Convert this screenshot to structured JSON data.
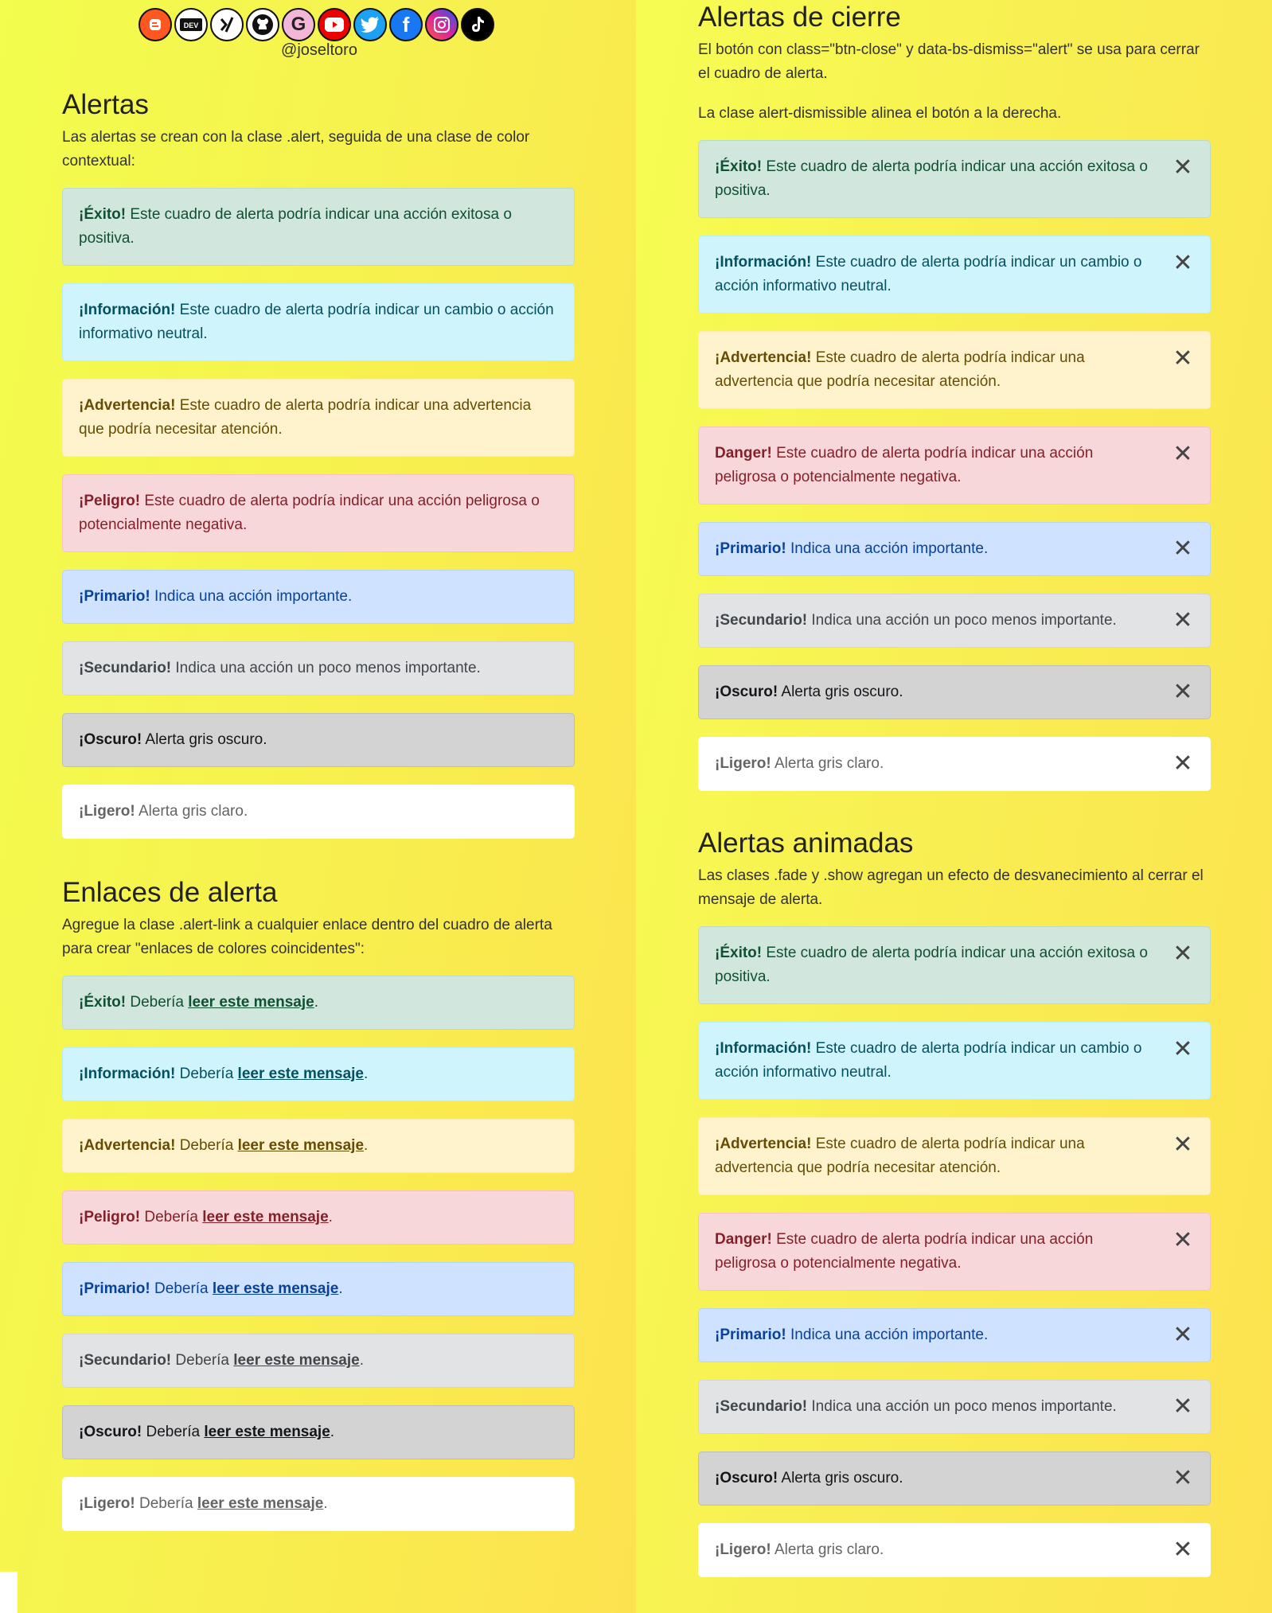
{
  "social": {
    "icons": [
      "blogger-icon",
      "dev-icon",
      "slash-icon",
      "github-icon",
      "google-icon",
      "youtube-icon",
      "twitter-icon",
      "facebook-icon",
      "instagram-icon",
      "tiktok-icon"
    ],
    "handle": "@joseltoro"
  },
  "left": {
    "section1": {
      "title": "Alertas",
      "desc": "Las alertas se crean con la clase .alert, seguida de una clase de color contextual:",
      "alerts": [
        {
          "strong": "¡Éxito!",
          "text": " Este cuadro de alerta podría indicar una acción exitosa o positiva."
        },
        {
          "strong": "¡Información!",
          "text": " Este cuadro de alerta podría indicar un cambio o acción informativo neutral."
        },
        {
          "strong": "¡Advertencia!",
          "text": " Este cuadro de alerta podría indicar una advertencia que podría necesitar atención."
        },
        {
          "strong": "¡Peligro!",
          "text": " Este cuadro de alerta podría indicar una acción peligrosa o potencialmente negativa."
        },
        {
          "strong": "¡Primario!",
          "text": " Indica una acción importante."
        },
        {
          "strong": "¡Secundario!",
          "text": " Indica una acción un poco menos importante."
        },
        {
          "strong": "¡Oscuro!",
          "text": " Alerta gris oscuro."
        },
        {
          "strong": "¡Ligero!",
          "text": " Alerta gris claro."
        }
      ]
    },
    "section2": {
      "title": "Enlaces de alerta",
      "desc": "Agregue la clase .alert-link a cualquier enlace dentro del cuadro de alerta para crear \"enlaces de colores coincidentes\":",
      "prefix": " Debería ",
      "link": "leer este mensaje",
      "suffix": ".",
      "alerts": [
        {
          "strong": "¡Éxito!"
        },
        {
          "strong": "¡Información!"
        },
        {
          "strong": "¡Advertencia!"
        },
        {
          "strong": "¡Peligro!"
        },
        {
          "strong": "¡Primario!"
        },
        {
          "strong": "¡Secundario!"
        },
        {
          "strong": "¡Oscuro!"
        },
        {
          "strong": "¡Ligero!"
        }
      ]
    }
  },
  "right": {
    "section1": {
      "title": "Alertas de cierre",
      "desc1": "El botón con class=\"btn-close\" y data-bs-dismiss=\"alert\" se usa para cerrar el cuadro de alerta.",
      "desc2": "La clase alert-dismissible alinea el botón a la derecha.",
      "alerts": [
        {
          "strong": "¡Éxito!",
          "text": " Este cuadro de alerta podría indicar una acción exitosa o positiva."
        },
        {
          "strong": "¡Información!",
          "text": " Este cuadro de alerta podría indicar un cambio o acción informativo neutral."
        },
        {
          "strong": "¡Advertencia!",
          "text": " Este cuadro de alerta podría indicar una advertencia que podría necesitar atención."
        },
        {
          "strong": "Danger!",
          "text": " Este cuadro de alerta podría indicar una acción peligrosa o potencialmente negativa."
        },
        {
          "strong": "¡Primario!",
          "text": " Indica una acción importante."
        },
        {
          "strong": "¡Secundario!",
          "text": " Indica una acción un poco menos importante."
        },
        {
          "strong": "¡Oscuro!",
          "text": " Alerta gris oscuro."
        },
        {
          "strong": "¡Ligero!",
          "text": " Alerta gris claro."
        }
      ]
    },
    "section2": {
      "title": "Alertas animadas",
      "desc": "Las clases .fade y .show agregan un efecto de desvanecimiento al cerrar el mensaje de alerta.",
      "alerts": [
        {
          "strong": "¡Éxito!",
          "text": " Este cuadro de alerta podría indicar una acción exitosa o positiva."
        },
        {
          "strong": "¡Información!",
          "text": " Este cuadro de alerta podría indicar un cambio o acción informativo neutral."
        },
        {
          "strong": "¡Advertencia!",
          "text": " Este cuadro de alerta podría indicar una advertencia que podría necesitar atención."
        },
        {
          "strong": "Danger!",
          "text": " Este cuadro de alerta podría indicar una acción peligrosa o potencialmente negativa."
        },
        {
          "strong": "¡Primario!",
          "text": " Indica una acción importante."
        },
        {
          "strong": "¡Secundario!",
          "text": " Indica una acción un poco menos importante."
        },
        {
          "strong": "¡Oscuro!",
          "text": " Alerta gris oscuro."
        },
        {
          "strong": "¡Ligero!",
          "text": " Alerta gris claro."
        }
      ]
    },
    "close_symbol": "✕"
  },
  "colors": {
    "success": "#d1e7dd",
    "info": "#cff4fc",
    "warning": "#fff3cd",
    "danger": "#f8d7da",
    "primary": "#cfe2ff",
    "secondary": "#e2e3e5",
    "dark": "#d3d3d4",
    "light": "#ffffff"
  }
}
